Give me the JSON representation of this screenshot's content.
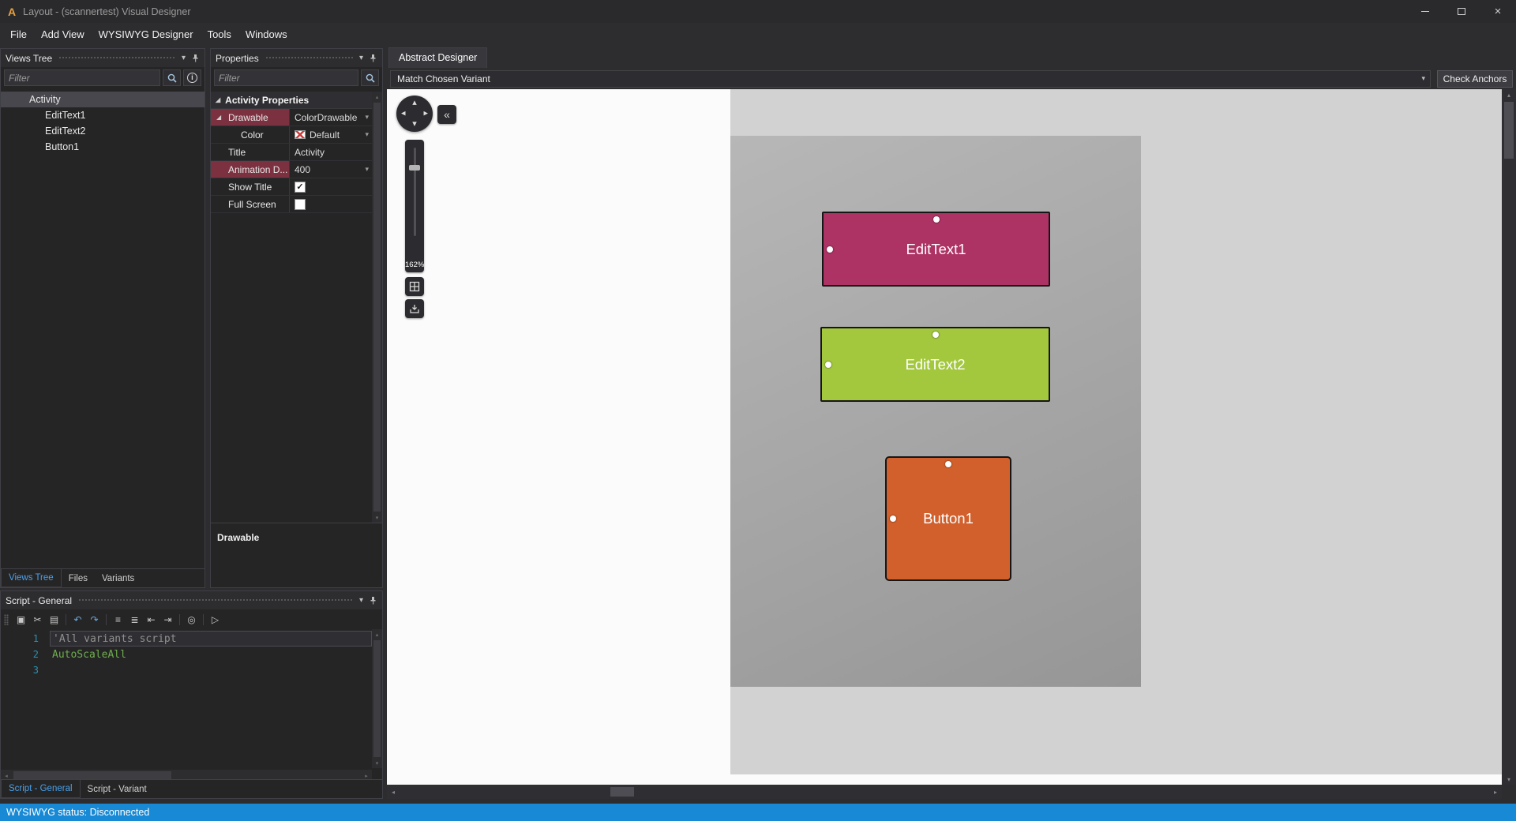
{
  "palette": {
    "accent_blue": "#4ba0e8",
    "status_bar": "#1789d5",
    "highlight_row": "#7b3140",
    "canvas_outer": "#d2d2d2",
    "canvas_screen": "#a8a8a8"
  },
  "window": {
    "logo": "A",
    "title": "Layout - (scannertest) Visual Designer"
  },
  "menu": {
    "items": [
      "File",
      "Add View",
      "WYSIWYG Designer",
      "Tools",
      "Windows"
    ]
  },
  "views_tree": {
    "title": "Views Tree",
    "filter_placeholder": "Filter",
    "items": [
      {
        "label": "Activity"
      },
      {
        "label": "EditText1"
      },
      {
        "label": "EditText2"
      },
      {
        "label": "Button1"
      }
    ],
    "tabs": [
      {
        "label": "Views Tree"
      },
      {
        "label": "Files"
      },
      {
        "label": "Variants"
      }
    ]
  },
  "properties": {
    "title": "Properties",
    "filter_placeholder": "Filter",
    "category": "Activity Properties",
    "rows": [
      {
        "label": "Drawable",
        "value": "ColorDrawable"
      },
      {
        "label": "Color",
        "value": "Default"
      },
      {
        "label": "Title",
        "value": "Activity"
      },
      {
        "label": "Animation D...",
        "value": "400"
      },
      {
        "label": "Show Title",
        "value": "checked"
      },
      {
        "label": "Full Screen",
        "value": "unchecked"
      }
    ],
    "description_title": "Drawable"
  },
  "script": {
    "title": "Script - General",
    "toolbar": [
      {
        "name": "copy",
        "glyph": "▣"
      },
      {
        "name": "cut",
        "glyph": "✂"
      },
      {
        "name": "paste",
        "glyph": "▤"
      },
      {
        "name": "undo",
        "glyph": "↶"
      },
      {
        "name": "redo",
        "glyph": "↷"
      },
      {
        "name": "comment",
        "glyph": "≡"
      },
      {
        "name": "uncomment",
        "glyph": "≣"
      },
      {
        "name": "outdent",
        "glyph": "⇤"
      },
      {
        "name": "indent",
        "glyph": "⇥"
      },
      {
        "name": "find",
        "glyph": "◎"
      },
      {
        "name": "run",
        "glyph": "▷"
      }
    ],
    "lines": [
      {
        "num": "1",
        "text": "'All variants script"
      },
      {
        "num": "2",
        "text": "AutoScaleAll"
      },
      {
        "num": "3",
        "text": ""
      }
    ],
    "tabs": [
      {
        "label": "Script - General"
      },
      {
        "label": "Script - Variant"
      }
    ]
  },
  "designer": {
    "tab": "Abstract Designer",
    "variant_selector": "Match Chosen Variant",
    "check_anchors_label": "Check Anchors",
    "zoom_percent": "162%",
    "widgets": [
      {
        "label": "EditText1",
        "color": "#ae3365"
      },
      {
        "label": "EditText2",
        "color": "#a3c83e"
      },
      {
        "label": "Button1",
        "color": "#d2602c"
      }
    ]
  },
  "status": {
    "text": "WYSIWYG status: Disconnected"
  },
  "icons": {
    "chevron_down": "▾",
    "close": "×",
    "category_expand": "◢",
    "check": "✓",
    "collapse_left": "«",
    "nav_up": "▴",
    "nav_down": "▾",
    "nav_left": "◂",
    "nav_right": "▸",
    "scroll_up": "▴",
    "scroll_down": "▾",
    "scroll_left": "◂",
    "scroll_right": "▸",
    "info": "i"
  }
}
